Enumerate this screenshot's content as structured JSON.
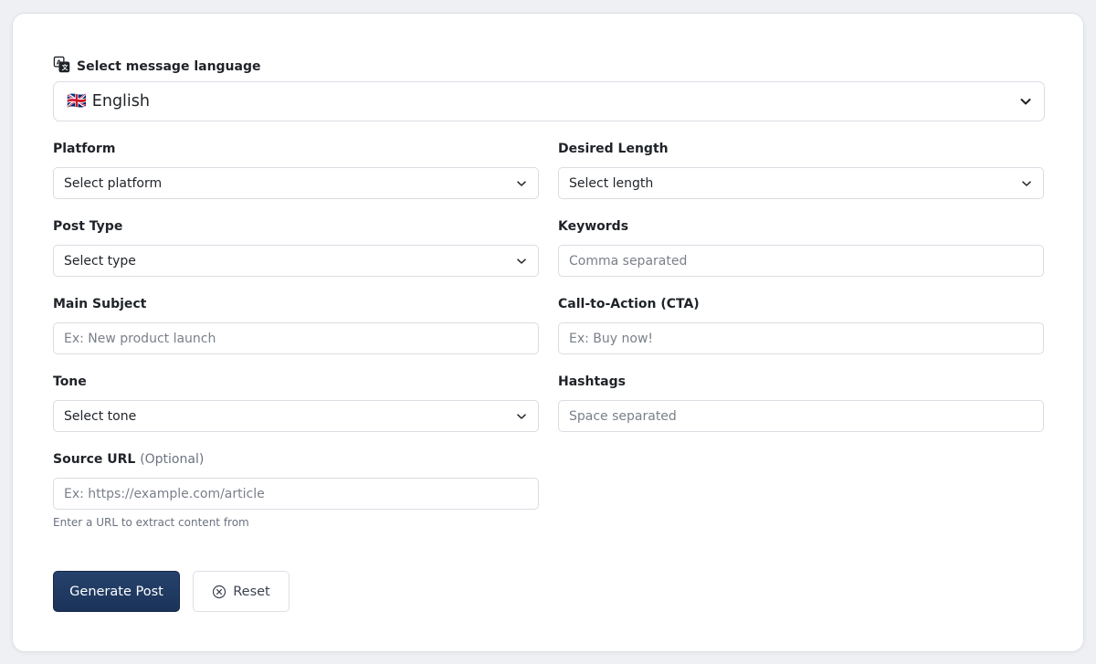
{
  "language": {
    "label": "Select message language",
    "icon": "translate-icon",
    "flag": "🇬🇧",
    "selected": "English"
  },
  "fields": {
    "platform": {
      "label": "Platform",
      "value": "Select platform"
    },
    "length": {
      "label": "Desired Length",
      "value": "Select length"
    },
    "post_type": {
      "label": "Post Type",
      "value": "Select type"
    },
    "keywords": {
      "label": "Keywords",
      "placeholder": "Comma separated"
    },
    "subject": {
      "label": "Main Subject",
      "placeholder": "Ex: New product launch"
    },
    "cta": {
      "label": "Call-to-Action (CTA)",
      "placeholder": "Ex: Buy now!"
    },
    "tone": {
      "label": "Tone",
      "value": "Select tone"
    },
    "hashtags": {
      "label": "Hashtags",
      "placeholder": "Space separated"
    },
    "source_url": {
      "label": "Source URL",
      "optional": "(Optional)",
      "placeholder": "Ex: https://example.com/article",
      "help": "Enter a URL to extract content from"
    }
  },
  "actions": {
    "generate": "Generate Post",
    "reset": "Reset"
  },
  "colors": {
    "primary": "#1f3a63",
    "border": "#d9dde2",
    "background": "#eef0f3"
  }
}
